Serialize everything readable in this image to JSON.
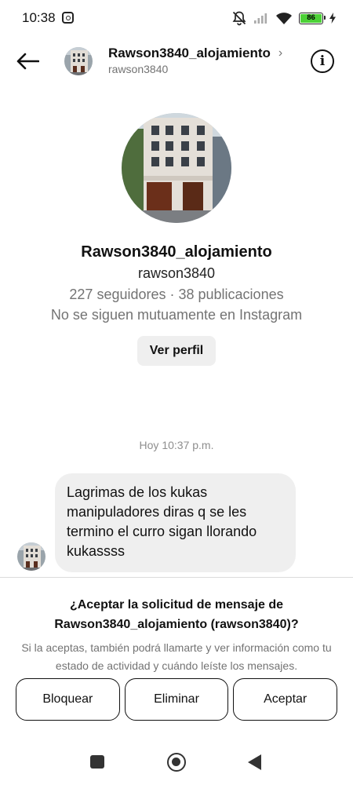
{
  "status_bar": {
    "time": "10:38",
    "battery_level": "86",
    "icons": [
      "instagram-notification-icon",
      "mute-icon",
      "signal-icon",
      "wifi-icon",
      "battery-icon",
      "charging-icon"
    ]
  },
  "header": {
    "name": "Rawson3840_alojamiento",
    "username": "rawson3840",
    "chevron": "›",
    "info_icon": "i"
  },
  "profile": {
    "name": "Rawson3840_alojamiento",
    "handle": "rawson3840",
    "stats": "227 seguidores · 38 publicaciones",
    "mutual": "No se siguen mutuamente en Instagram",
    "view_profile_label": "Ver perfil"
  },
  "conversation": {
    "timestamp": "Hoy 10:37 p.m.",
    "messages": [
      {
        "text": "Lagrimas de los kukas manipuladores diras q se les termino el curro sigan llorando kukassss"
      }
    ]
  },
  "request": {
    "title": "¿Aceptar la solicitud de mensaje de Rawson3840_alojamiento (rawson3840)?",
    "description": "Si la aceptas, también podrá llamarte y ver información como tu estado de actividad y cuándo leíste los mensajes.",
    "block_label": "Bloquear",
    "delete_label": "Eliminar",
    "accept_label": "Aceptar"
  },
  "colors": {
    "accent_battery": "#4cd137",
    "bubble_bg": "#efefef",
    "secondary_text": "#737373"
  }
}
